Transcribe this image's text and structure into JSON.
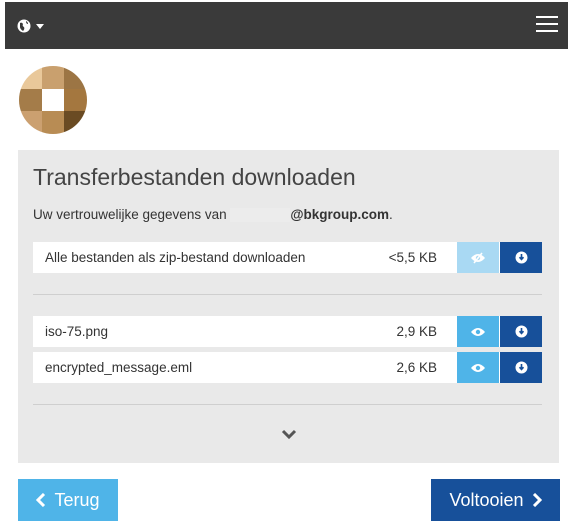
{
  "topbar": {
    "globe_icon": "globe-icon",
    "menu_icon": "hamburger-menu-icon"
  },
  "logo": {
    "colors": [
      "#e9c89a",
      "#c9a06e",
      "#9c7544",
      "#a47c49",
      "#ffffff",
      "#a4773f",
      "#cba070",
      "#b88c54",
      "#6a4b23"
    ]
  },
  "panel": {
    "title": "Transferbestanden downloaden",
    "intro_prefix": "Uw vertrouwelijke gegevens van",
    "intro_domain": "@bkgroup.com",
    "intro_suffix": "."
  },
  "zip_row": {
    "label": "Alle bestanden als zip-bestand downloaden",
    "size": "<5,5 KB"
  },
  "files": [
    {
      "name": "iso-75.png",
      "size": "2,9 KB"
    },
    {
      "name": "encrypted_message.eml",
      "size": "2,6 KB"
    }
  ],
  "footer": {
    "back_label": "Terug",
    "done_label": "Voltooien"
  },
  "colors": {
    "topbar": "#3a3a3a",
    "panel": "#e9e9e9",
    "light_blue": "#4fb4e8",
    "dark_blue": "#17509a"
  }
}
